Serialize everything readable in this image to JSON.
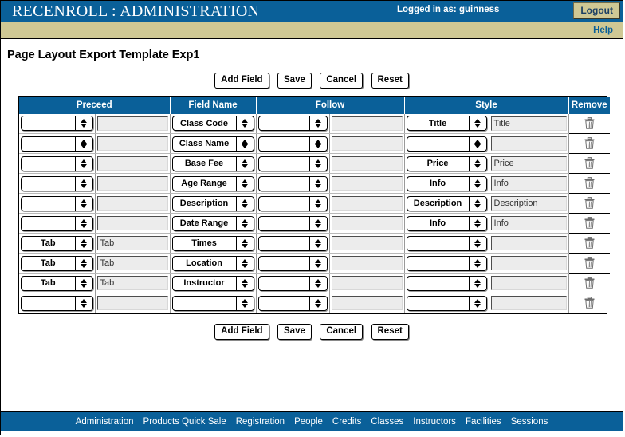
{
  "header": {
    "app_title": "RECENROLL : ADMINISTRATION",
    "login_status": "Logged in as: guinness",
    "logout_label": "Logout",
    "help_label": "Help"
  },
  "colors": {
    "header_blue": "#0a6099",
    "band_tan": "#cfc894",
    "link_white": "#ffffff"
  },
  "main": {
    "page_title": "Page Layout Export Template Exp1",
    "toolbar": {
      "add_field": "Add Field",
      "save": "Save",
      "cancel": "Cancel",
      "reset": "Reset"
    },
    "table": {
      "columns": [
        "Preceed",
        "Field Name",
        "Follow",
        "Style",
        "Remove"
      ],
      "rows": [
        {
          "preceed_select": "",
          "preceed_text": "",
          "field_name": "Class Code",
          "follow_select": "",
          "follow_text": "",
          "style_select": "Title",
          "style_text": "Title"
        },
        {
          "preceed_select": "",
          "preceed_text": "",
          "field_name": "Class Name",
          "follow_select": "",
          "follow_text": "",
          "style_select": "",
          "style_text": ""
        },
        {
          "preceed_select": "",
          "preceed_text": "",
          "field_name": "Base Fee",
          "follow_select": "",
          "follow_text": "",
          "style_select": "Price",
          "style_text": "Price"
        },
        {
          "preceed_select": "",
          "preceed_text": "",
          "field_name": "Age Range",
          "follow_select": "",
          "follow_text": "",
          "style_select": "Info",
          "style_text": "Info"
        },
        {
          "preceed_select": "",
          "preceed_text": "",
          "field_name": "Description",
          "follow_select": "",
          "follow_text": "",
          "style_select": "Description",
          "style_text": "Description"
        },
        {
          "preceed_select": "",
          "preceed_text": "",
          "field_name": "Date Range",
          "follow_select": "",
          "follow_text": "",
          "style_select": "Info",
          "style_text": "Info"
        },
        {
          "preceed_select": "Tab",
          "preceed_text": "Tab",
          "field_name": "Times",
          "follow_select": "",
          "follow_text": "",
          "style_select": "",
          "style_text": ""
        },
        {
          "preceed_select": "Tab",
          "preceed_text": "Tab",
          "field_name": "Location",
          "follow_select": "",
          "follow_text": "",
          "style_select": "",
          "style_text": ""
        },
        {
          "preceed_select": "Tab",
          "preceed_text": "Tab",
          "field_name": "Instructor",
          "follow_select": "",
          "follow_text": "",
          "style_select": "",
          "style_text": ""
        },
        {
          "preceed_select": "",
          "preceed_text": "",
          "field_name": "",
          "follow_select": "",
          "follow_text": "",
          "style_select": "",
          "style_text": ""
        }
      ]
    }
  },
  "footer": {
    "links": [
      "Administration",
      "Products Quick Sale",
      "Registration",
      "People",
      "Credits",
      "Classes",
      "Instructors",
      "Facilities",
      "Sessions"
    ]
  }
}
